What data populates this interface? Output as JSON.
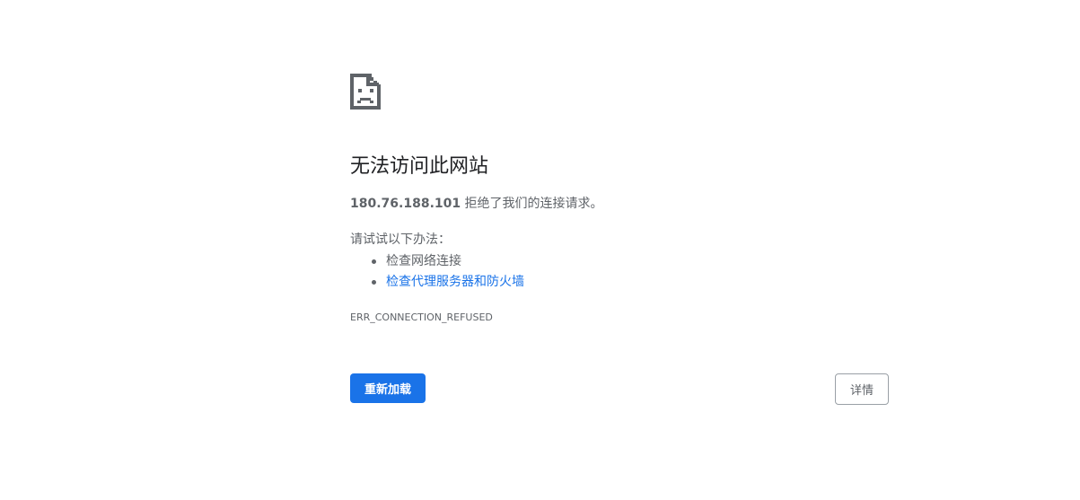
{
  "icon": "sad-page-icon",
  "colors": {
    "primary_button": "#1a73e8",
    "link": "#1a73e8",
    "title": "#202124",
    "body_text": "#5f6368"
  },
  "main": {
    "title": "无法访问此网站",
    "host": "180.76.188.101",
    "summary_suffix": " 拒绝了我们的连接请求。",
    "suggestions_heading": "请试试以下办法：",
    "suggestions": [
      {
        "label": "检查网络连接",
        "is_link": false
      },
      {
        "label": "检查代理服务器和防火墙",
        "is_link": true
      }
    ],
    "error_code": "ERR_CONNECTION_REFUSED"
  },
  "buttons": {
    "reload_label": "重新加载",
    "details_label": "详情"
  }
}
